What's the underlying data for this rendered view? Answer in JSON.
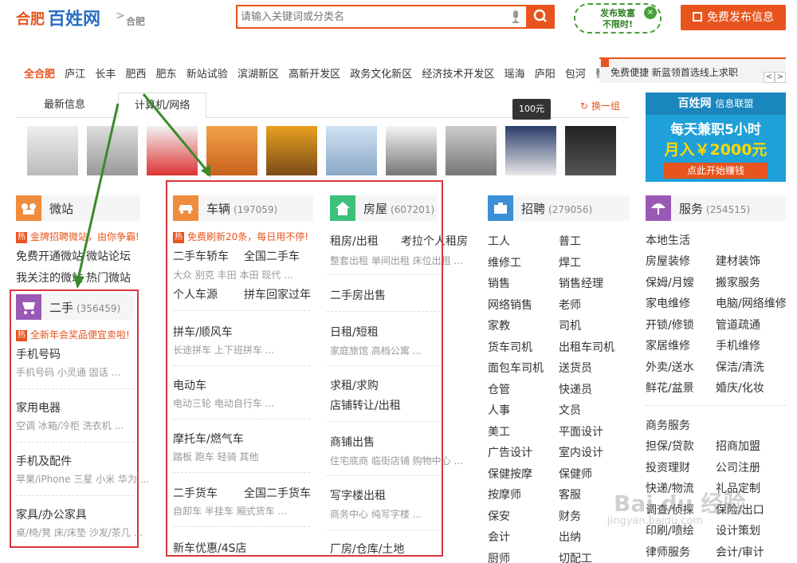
{
  "header": {
    "city": "合肥",
    "site_name": "百姓网",
    "breadcrumb_sep": ">",
    "sub_city": "合肥",
    "search_placeholder": "请输入关键词或分类名",
    "badge_free": "发布致富\n不限时!",
    "publish_label": "免费发布信息"
  },
  "nav": {
    "districts": [
      "全合肥",
      "庐江",
      "长丰",
      "肥西",
      "肥东",
      "新站试验",
      "滨湖新区",
      "高新开发区",
      "政务文化新区",
      "经济技术开发区",
      "瑶海",
      "庐阳",
      "包河",
      "蜀山"
    ],
    "notice": "免费便捷 新蓝领首选线上求职",
    "prev": "<",
    "next": ">"
  },
  "tabs": {
    "items": [
      "最新信息",
      "计算机/网络"
    ],
    "refresh": "换一组",
    "price_tip": "100元"
  },
  "ad": {
    "brand": "百姓网",
    "brand_sub": "信息联盟",
    "line1": "每天兼职5小时",
    "line2": "月入￥2000元",
    "button": "点此开始赚钱"
  },
  "columns": {
    "weizhan": {
      "title": "微站",
      "hot": "金牌招聘微站，由你争霸!",
      "links": [
        "免费开通微站",
        "微站论坛",
        "我关注的微站",
        "热门微站"
      ]
    },
    "ershou": {
      "title": "二手",
      "count": "(356459)",
      "hot": "全新年会奖品便宜卖啦!",
      "items": [
        {
          "label": "手机号码",
          "sub": "手机号码 小灵通 固话 ..."
        },
        {
          "label": "家用电器",
          "sub": "空调 冰箱/冷柜 洗衣机 ..."
        },
        {
          "label": "手机及配件",
          "sub": "苹果/iPhone 三星 小米 华为 ..."
        },
        {
          "label": "家具/办公家具",
          "sub": "桌/椅/凳 床/床垫 沙发/茶几 ..."
        }
      ]
    },
    "cheliang": {
      "title": "车辆",
      "count": "(197059)",
      "hot": "免费刷新20条，每日用不停!",
      "items": [
        {
          "label": "二手车轿车",
          "label2": "全国二手车",
          "sub": "大众 别克 丰田 本田 现代 ..."
        },
        {
          "label": "个人车源",
          "label2": "拼车回家过年",
          "sub": ""
        },
        {
          "label": "拼车/顺风车",
          "sub": "长途拼车 上下班拼车 ..."
        },
        {
          "label": "电动车",
          "sub": "电动三轮 电动自行车 ..."
        },
        {
          "label": "摩托车/燃气车",
          "sub": "踏板 跑车 轻骑 其他"
        },
        {
          "label": "二手货车",
          "label2": "全国二手货车",
          "sub": "自卸车 半挂车 厢式货车 ..."
        },
        {
          "label": "新车优惠/4S店",
          "sub": ""
        }
      ]
    },
    "fangwu": {
      "title": "房屋",
      "count": "(607201)",
      "items": [
        {
          "label": "租房/出租",
          "label2": "考拉个人租房",
          "sub": "整套出租 单间出租 床位出租 ..."
        },
        {
          "label": "二手房出售",
          "sub": ""
        },
        {
          "label": "日租/短租",
          "sub": "家庭旅馆 高档公寓 ..."
        },
        {
          "label": "求租/求购",
          "label2": "店铺转让/出租",
          "sub": ""
        },
        {
          "label": "商铺出售",
          "sub": "住宅底商 临街店铺 购物中心 ..."
        },
        {
          "label": "写字楼出租",
          "sub": "商务中心 纯写字楼 ..."
        },
        {
          "label": "厂房/仓库/土地",
          "sub": ""
        }
      ]
    },
    "zhaopin": {
      "title": "招聘",
      "count": "(279056)",
      "left": [
        "工人",
        "维修工",
        "销售",
        "网络销售",
        "家教",
        "货车司机",
        "面包车司机",
        "仓管",
        "人事",
        "美工",
        "广告设计",
        "保健按摩",
        "按摩师",
        "保安",
        "会计",
        "厨师"
      ],
      "right": [
        "普工",
        "焊工",
        "销售经理",
        "老师",
        "司机",
        "出租车司机",
        "送货员",
        "快递员",
        "文员",
        "平面设计",
        "室内设计",
        "保健师",
        "客服",
        "财务",
        "出纳",
        "切配工"
      ]
    },
    "fuwu": {
      "title": "服务",
      "count": "(254515)",
      "local_title": "本地生活",
      "local_left": [
        "房屋装修",
        "保姆/月嫂",
        "家电维修",
        "开锁/修锁",
        "家居维修",
        "外卖/送水",
        "鲜花/盆景"
      ],
      "local_right": [
        "建材装饰",
        "搬家服务",
        "电脑/网络维修",
        "管道疏通",
        "手机维修",
        "保洁/清洗",
        "婚庆/化妆"
      ],
      "biz_title": "商务服务",
      "biz_left": [
        "担保/贷款",
        "投资理财",
        "快递/物流",
        "调查/侦探",
        "印刷/喷绘",
        "律师服务"
      ],
      "biz_right": [
        "招商加盟",
        "公司注册",
        "礼品定制",
        "保险/出口",
        "设计策划",
        "会计/审计"
      ]
    }
  },
  "watermark": {
    "text": "Bai du 经验",
    "url": "jingyan.baidu.com"
  },
  "colors": {
    "accent": "#e8541e",
    "brand_blue": "#2b6fc2",
    "annotation_red": "#d9363e",
    "annotation_green": "#3a8a2c"
  }
}
